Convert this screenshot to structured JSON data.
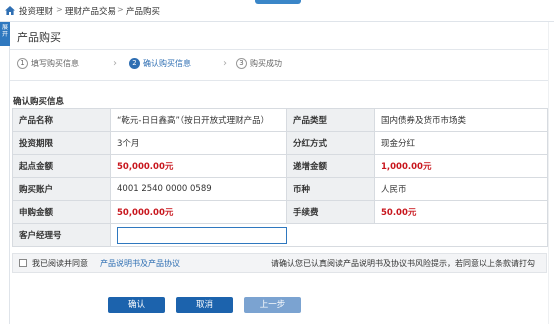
{
  "breadcrumb": {
    "items": [
      "投资理财",
      "理财产品交易",
      "产品购买"
    ],
    "separator": ">"
  },
  "side_tab": "展开",
  "panel": {
    "title": "产品购买"
  },
  "steps": [
    {
      "num": "1",
      "label": "填写购买信息"
    },
    {
      "num": "2",
      "label": "确认购买信息"
    },
    {
      "num": "3",
      "label": "购买成功"
    }
  ],
  "section_title": "确认购买信息",
  "table": {
    "rows": [
      {
        "l1": "产品名称",
        "v1": "“乾元-日日鑫高”（按日开放式理财产品）",
        "l2": "产品类型",
        "v2": "国内债券及货币市场类"
      },
      {
        "l1": "投资期限",
        "v1": "3个月",
        "l2": "分红方式",
        "v2": "现金分红"
      },
      {
        "l1": "起点金额",
        "v1": "50,000.00元",
        "l2": "递增金额",
        "v2": "1,000.00元"
      },
      {
        "l1": "购买账户",
        "v1": "4001 2540 0000 0589",
        "l2": "币种",
        "v2": "人民币"
      },
      {
        "l1": "申购金额",
        "v1": "50,000.00元",
        "l2": "手续费",
        "v2": "50.00元"
      },
      {
        "l1": "客户经理号",
        "v1": ""
      }
    ]
  },
  "agreement": {
    "prefix": "我已阅读并同意",
    "link": "产品说明书及产品协议",
    "notice": "请确认您已认真阅读产品说明书及协议书风险提示，若同意以上条款请打勾"
  },
  "buttons": {
    "confirm": "确认",
    "cancel": "取消",
    "prev": "上一步"
  },
  "colors": {
    "accent": "#1c63ad",
    "amount_red": "#c8161d",
    "disabled_button": "#7ba3d1"
  }
}
